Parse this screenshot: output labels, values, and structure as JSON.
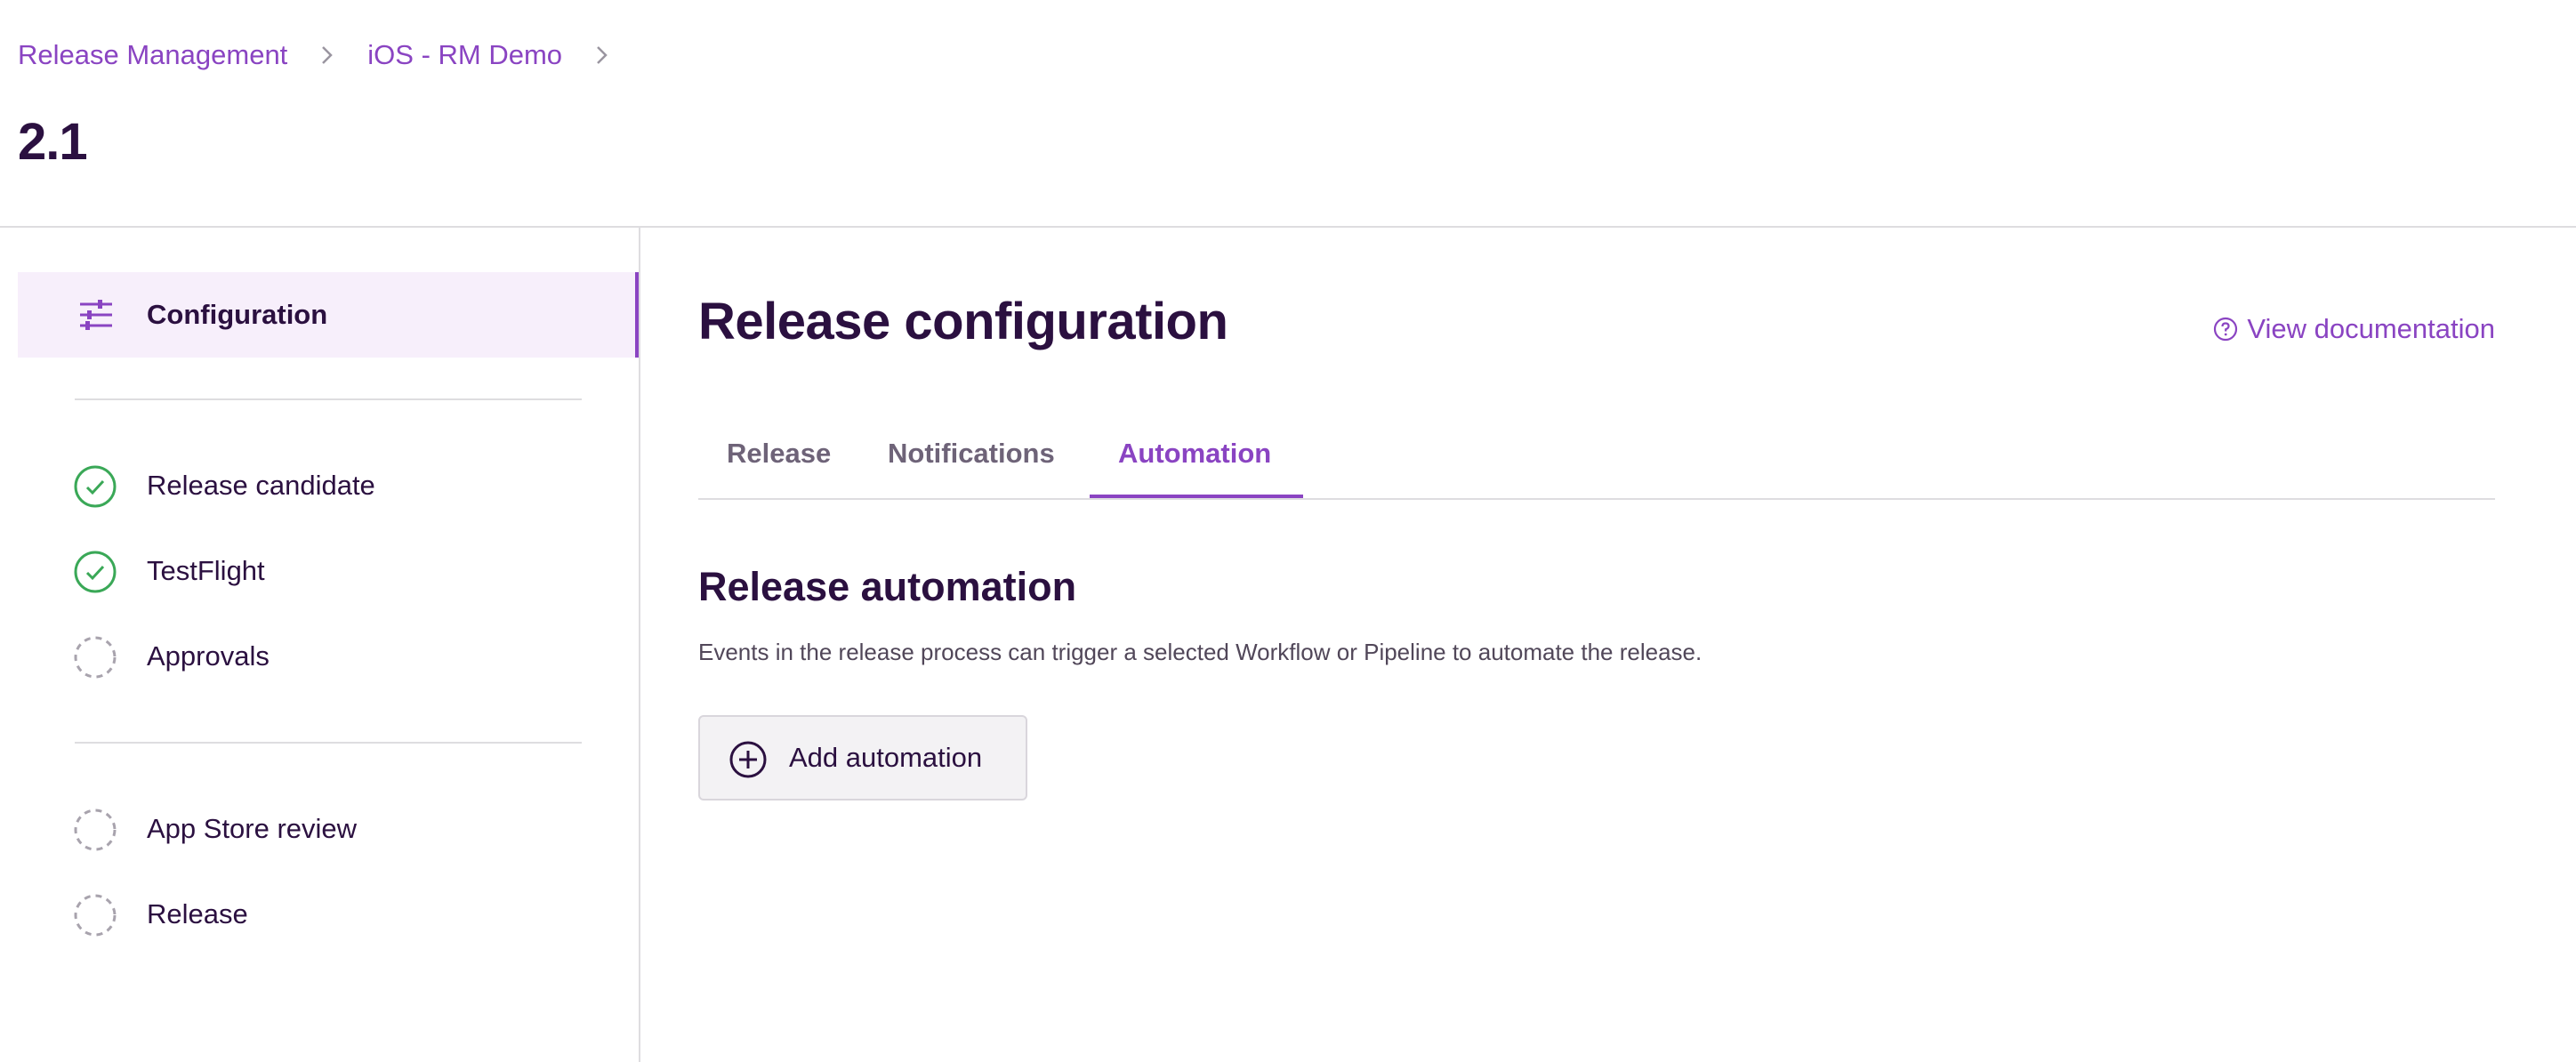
{
  "breadcrumb": {
    "items": [
      "Release Management",
      "iOS - RM Demo"
    ]
  },
  "header": {
    "title": "2.1"
  },
  "sidebar": {
    "config_label": "Configuration",
    "group1": [
      {
        "label": "Release candidate",
        "status": "complete"
      },
      {
        "label": "TestFlight",
        "status": "complete"
      },
      {
        "label": "Approvals",
        "status": "pending"
      }
    ],
    "group2": [
      {
        "label": "App Store review",
        "status": "pending"
      },
      {
        "label": "Release",
        "status": "pending"
      }
    ]
  },
  "main": {
    "title": "Release configuration",
    "doc_link": "View documentation",
    "tabs": [
      {
        "label": "Release",
        "active": false
      },
      {
        "label": "Notifications",
        "active": false
      },
      {
        "label": "Automation",
        "active": true
      }
    ],
    "section_title": "Release automation",
    "section_desc": "Events in the release process can trigger a selected Workflow or Pipeline to automate the release.",
    "add_button": "Add automation"
  },
  "colors": {
    "accent": "#8a44c2",
    "text": "#2b1040",
    "success": "#3aa857",
    "pending": "#a8a3ad"
  }
}
